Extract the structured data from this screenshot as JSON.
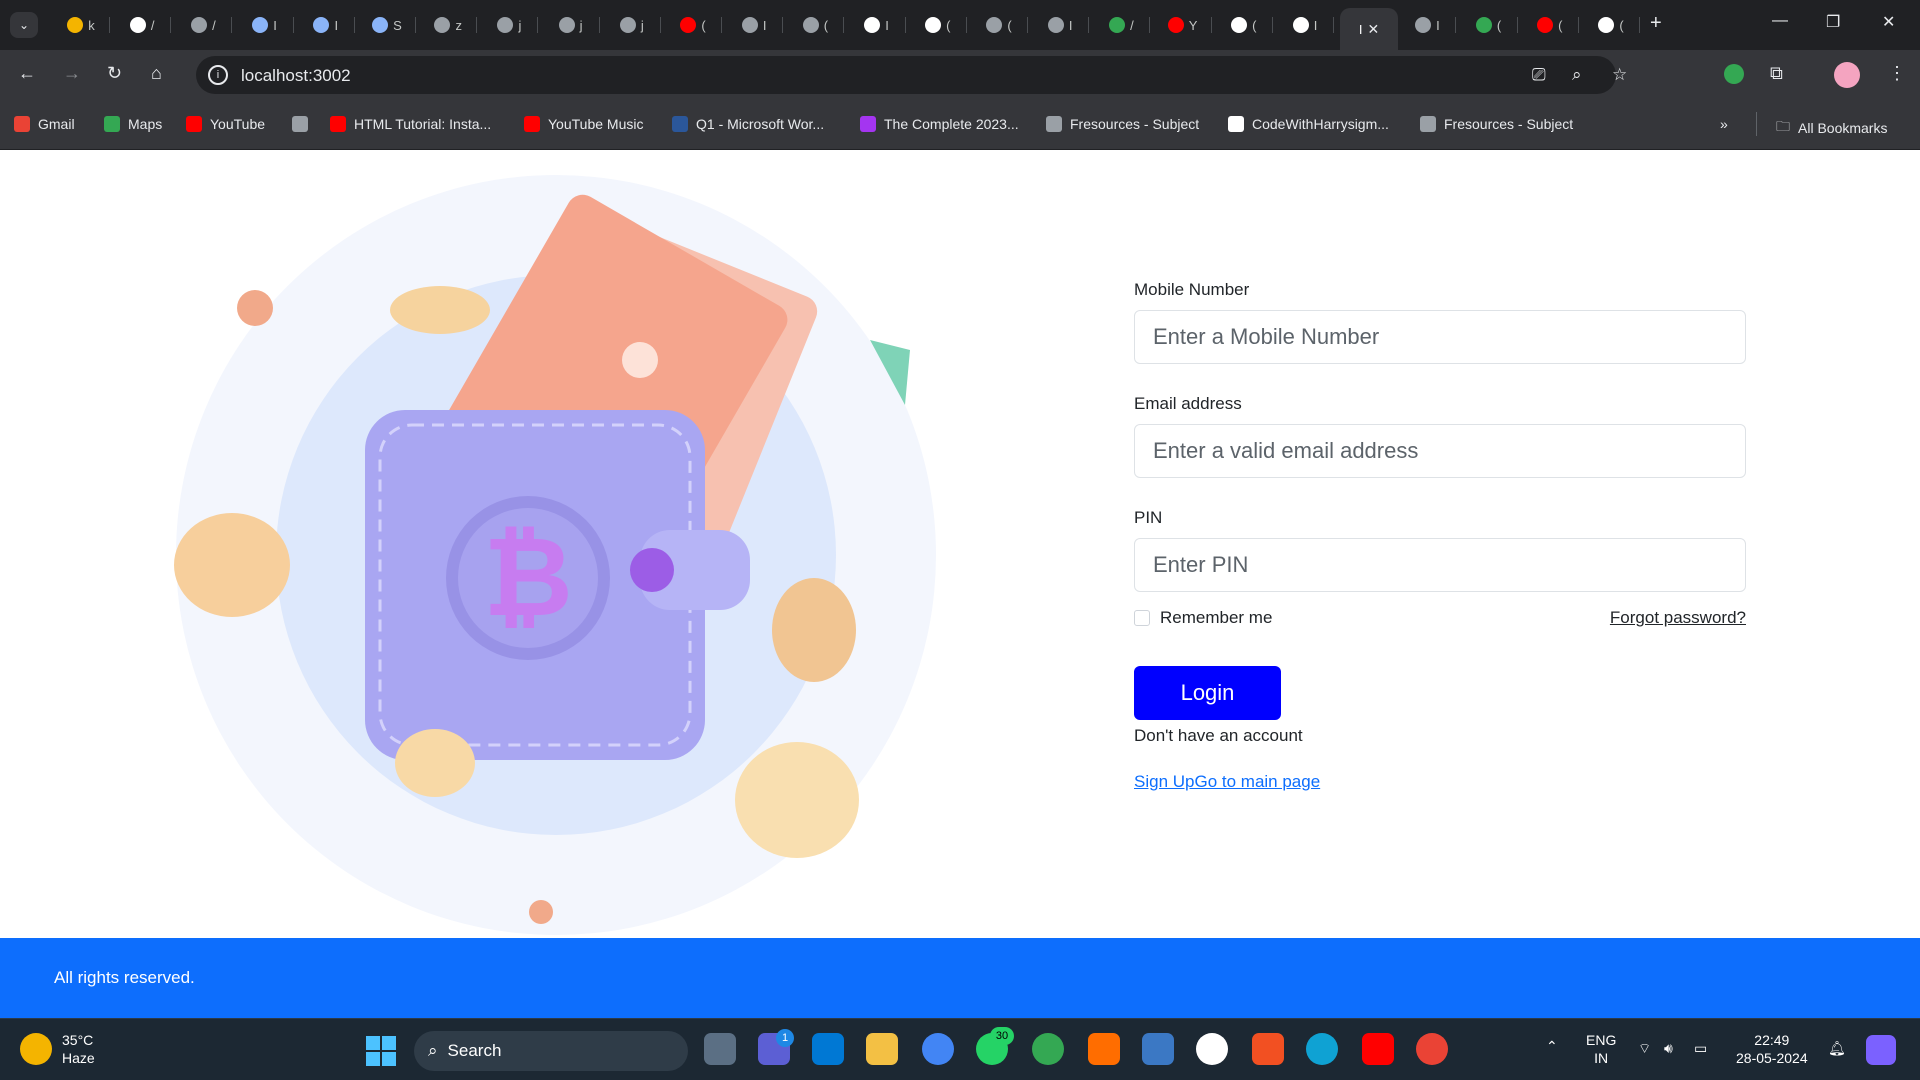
{
  "browser": {
    "active_tab_label": "I",
    "url": "localhost:3002",
    "tab_letters": [
      "k",
      "/",
      "/",
      "I",
      "I",
      "S",
      "z",
      "j",
      "j",
      "j",
      "(",
      "I",
      "(",
      "I",
      "(",
      "(",
      "I",
      "/",
      "Y",
      "(",
      "I",
      "I",
      "I",
      "(",
      "(",
      "("
    ]
  },
  "bookmarks": [
    {
      "label": "Gmail",
      "color": "#ea4335"
    },
    {
      "label": "Maps",
      "color": "#34a853"
    },
    {
      "label": "YouTube",
      "color": "#ff0000"
    },
    {
      "label": "",
      "color": "#9aa0a6"
    },
    {
      "label": "HTML Tutorial: Insta...",
      "color": "#ff0000"
    },
    {
      "label": "YouTube Music",
      "color": "#ff0000"
    },
    {
      "label": "Q1 - Microsoft Wor...",
      "color": "#2b579a"
    },
    {
      "label": "The Complete 2023...",
      "color": "#a435f0"
    },
    {
      "label": "Fresources - Subject",
      "color": "#9aa0a6"
    },
    {
      "label": "CodeWithHarrysigm...",
      "color": "#ffffff"
    },
    {
      "label": "Fresources - Subject",
      "color": "#9aa0a6"
    }
  ],
  "bookmarks_more": "»",
  "all_bookmarks": "All Bookmarks",
  "form": {
    "mobile_label": "Mobile Number",
    "mobile_placeholder": "Enter a Mobile Number",
    "email_label": "Email address",
    "email_placeholder": "Enter a valid email address",
    "pin_label": "PIN",
    "pin_placeholder": "Enter PIN",
    "remember_label": "Remember me",
    "forgot_label": "Forgot password?",
    "login_label": "Login",
    "no_account_text": "Don't have an account",
    "signup_link": "Sign UpGo to main page"
  },
  "footer": {
    "text": "All rights reserved."
  },
  "taskbar": {
    "weather_temp": "35°C",
    "weather_desc": "Haze",
    "search_label": "Search",
    "lang_top": "ENG",
    "lang_bottom": "IN",
    "time": "22:49",
    "date": "28-05-2024",
    "whatsapp_badge": "30",
    "teams_badge": "1"
  },
  "colors": {
    "primary": "#0d6efd",
    "login_button": "#0000ff",
    "browser_dark": "#202124",
    "browser_toolbar": "#35363a"
  }
}
